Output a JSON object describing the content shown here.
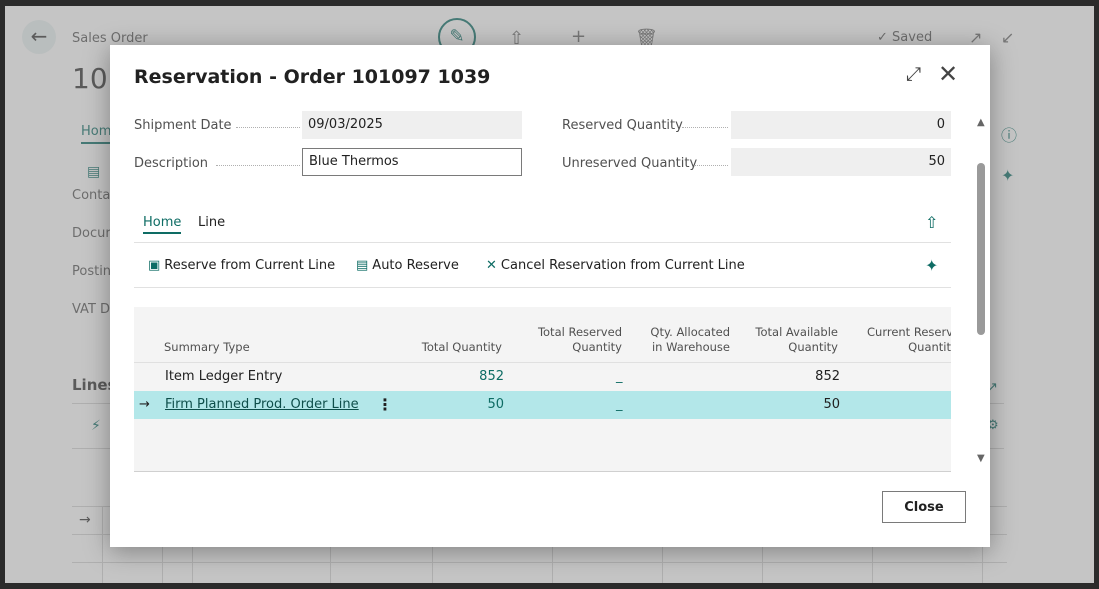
{
  "background": {
    "breadcrumb": "Sales Order",
    "title_partial": "101",
    "saved_label": "Saved",
    "tab_home": "Hom",
    "fields": [
      "Conta",
      "Docur",
      "Postin",
      "VAT D"
    ],
    "lines_label": "Lines"
  },
  "modal": {
    "title": "Reservation - Order 101097 1039",
    "fields": {
      "shipment_date": {
        "label": "Shipment Date",
        "value": "09/03/2025"
      },
      "description": {
        "label": "Description",
        "value": "Blue Thermos"
      },
      "reserved_quantity": {
        "label": "Reserved Quantity",
        "value": "0"
      },
      "unreserved_quantity": {
        "label": "Unreserved Quantity",
        "value": "50"
      }
    },
    "tabs": [
      {
        "label": "Home",
        "active": true
      },
      {
        "label": "Line",
        "active": false
      }
    ],
    "actions": [
      {
        "label": "Reserve from Current Line",
        "icon": "reserve-icon"
      },
      {
        "label": "Auto Reserve",
        "icon": "auto-reserve-icon"
      },
      {
        "label": "Cancel Reservation from Current Line",
        "icon": "cancel-x-icon"
      }
    ],
    "grid": {
      "headers": {
        "summary_type": "Summary Type",
        "total_quantity": "Total Quantity",
        "total_reserved_1": "Total Reserved",
        "total_reserved_2": "Quantity",
        "qty_allocated_1": "Qty. Allocated",
        "qty_allocated_2": "in Warehouse",
        "total_available_1": "Total Available",
        "total_available_2": "Quantity",
        "current_reserved_1": "Current Reserve",
        "current_reserved_2": "Quantit"
      },
      "rows": [
        {
          "summary_type": "Item Ledger Entry",
          "total_quantity": "852",
          "total_reserved": "_",
          "total_available": "852"
        },
        {
          "summary_type": "Firm Planned Prod. Order Line",
          "total_quantity": "50",
          "total_reserved": "_",
          "total_available": "50"
        }
      ]
    },
    "close_label": "Close"
  },
  "colors": {
    "accent": "#0e6c64",
    "selected_row": "#b3e7e9"
  }
}
